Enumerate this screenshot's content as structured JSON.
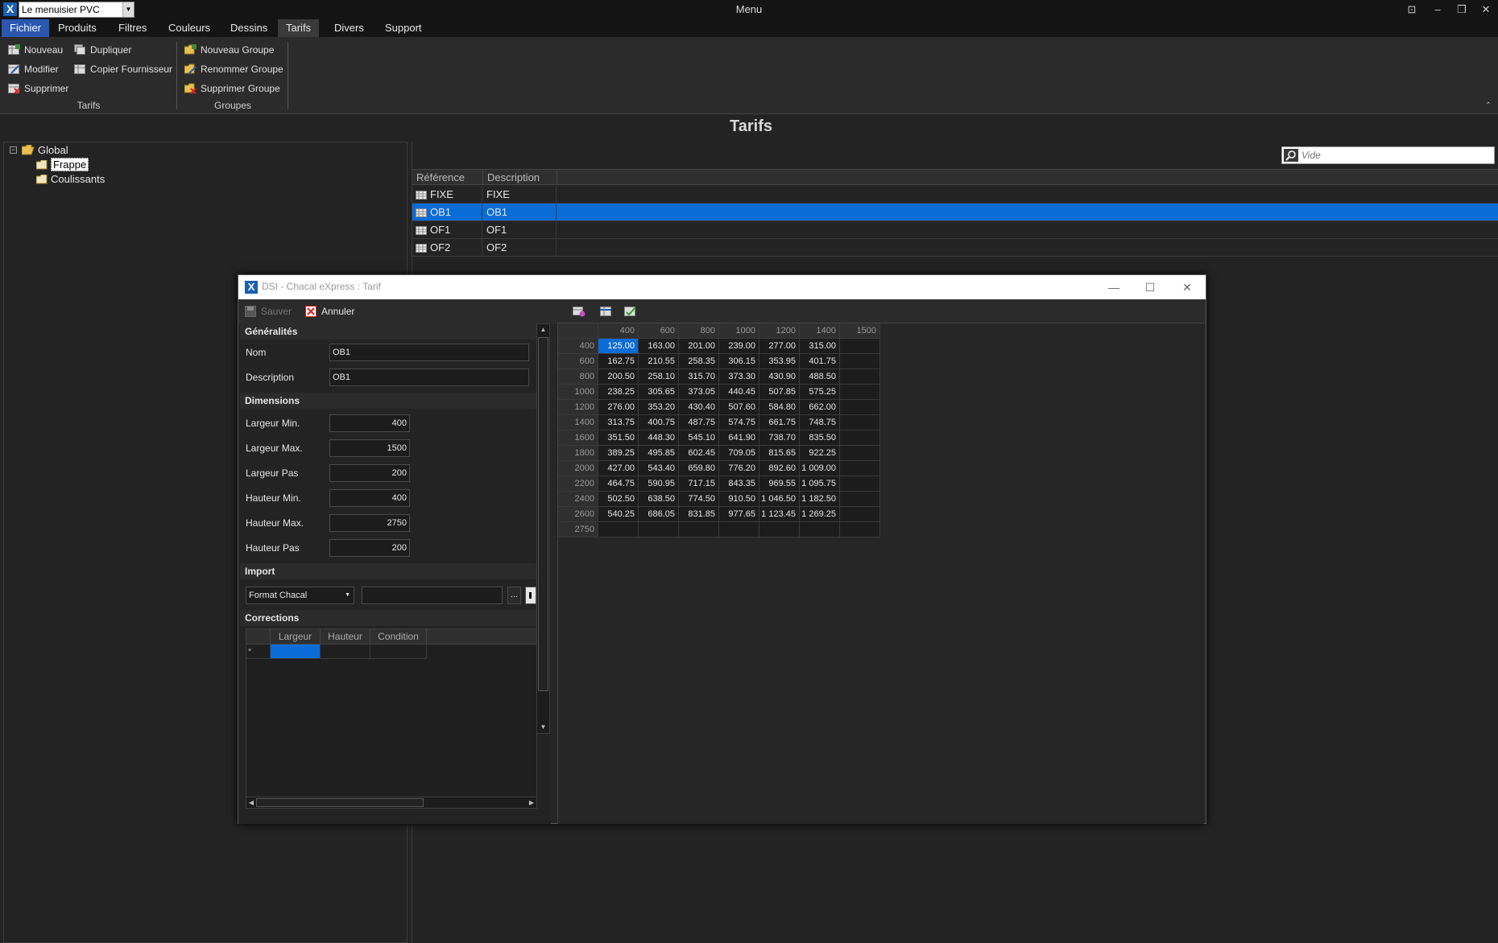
{
  "titlebar": {
    "company": "Le menuisier PVC",
    "title": "Menu"
  },
  "menu": {
    "tabs": [
      "Fichier",
      "Produits",
      "Filtres",
      "Couleurs",
      "Dessins",
      "Tarifs",
      "Divers",
      "Support"
    ]
  },
  "ribbon": {
    "tarifs_group": {
      "label": "Tarifs",
      "nouveau": "Nouveau",
      "modifier": "Modifier",
      "supprimer": "Supprimer",
      "dupliquer": "Dupliquer",
      "copier_fournisseur": "Copier Fournisseur"
    },
    "groupes_group": {
      "label": "Groupes",
      "nouveau_groupe": "Nouveau Groupe",
      "renommer_groupe": "Renommer Groupe",
      "supprimer_groupe": "Supprimer Groupe"
    }
  },
  "page": {
    "title": "Tarifs"
  },
  "tree": {
    "root": "Global",
    "children": [
      "Frappe",
      "Coulissants"
    ]
  },
  "search": {
    "placeholder": "Vide"
  },
  "list": {
    "headers": [
      "Référence",
      "Description"
    ],
    "rows": [
      {
        "ref": "FIXE",
        "desc": "FIXE"
      },
      {
        "ref": "OB1",
        "desc": "OB1"
      },
      {
        "ref": "OF1",
        "desc": "OF1"
      },
      {
        "ref": "OF2",
        "desc": "OF2"
      }
    ]
  },
  "dialog": {
    "title": "DSI - Chacal eXpress : Tarif",
    "toolbar": {
      "save": "Sauver",
      "cancel": "Annuler"
    },
    "sections": {
      "general": "Généralités",
      "dimensions": "Dimensions",
      "import": "Import",
      "corrections": "Corrections"
    },
    "fields": {
      "nom_label": "Nom",
      "nom_value": "OB1",
      "description_label": "Description",
      "description_value": "OB1",
      "largeur_min_label": "Largeur Min.",
      "largeur_min": "400",
      "largeur_max_label": "Largeur Max.",
      "largeur_max": "1500",
      "largeur_pas_label": "Largeur Pas",
      "largeur_pas": "200",
      "hauteur_min_label": "Hauteur Min.",
      "hauteur_min": "400",
      "hauteur_max_label": "Hauteur Max.",
      "hauteur_max": "2750",
      "hauteur_pas_label": "Hauteur Pas",
      "hauteur_pas": "200"
    },
    "import": {
      "format": "Format Chacal",
      "browse": "..."
    },
    "corrections": {
      "headers": [
        "Largeur",
        "Hauteur",
        "Condition"
      ],
      "new_row_marker": "*"
    },
    "price_grid": {
      "columns": [
        "400",
        "600",
        "800",
        "1000",
        "1200",
        "1400",
        "1500"
      ],
      "rows": [
        {
          "h": "400",
          "v": [
            "125.00",
            "163.00",
            "201.00",
            "239.00",
            "277.00",
            "315.00",
            ""
          ]
        },
        {
          "h": "600",
          "v": [
            "162.75",
            "210.55",
            "258.35",
            "306.15",
            "353.95",
            "401.75",
            ""
          ]
        },
        {
          "h": "800",
          "v": [
            "200.50",
            "258.10",
            "315.70",
            "373.30",
            "430.90",
            "488.50",
            ""
          ]
        },
        {
          "h": "1000",
          "v": [
            "238.25",
            "305.65",
            "373.05",
            "440.45",
            "507.85",
            "575.25",
            ""
          ]
        },
        {
          "h": "1200",
          "v": [
            "276.00",
            "353.20",
            "430.40",
            "507.60",
            "584.80",
            "662.00",
            ""
          ]
        },
        {
          "h": "1400",
          "v": [
            "313.75",
            "400.75",
            "487.75",
            "574.75",
            "661.75",
            "748.75",
            ""
          ]
        },
        {
          "h": "1600",
          "v": [
            "351.50",
            "448.30",
            "545.10",
            "641.90",
            "738.70",
            "835.50",
            ""
          ]
        },
        {
          "h": "1800",
          "v": [
            "389.25",
            "495.85",
            "602.45",
            "709.05",
            "815.65",
            "922.25",
            ""
          ]
        },
        {
          "h": "2000",
          "v": [
            "427.00",
            "543.40",
            "659.80",
            "776.20",
            "892.60",
            "1 009.00",
            ""
          ]
        },
        {
          "h": "2200",
          "v": [
            "464.75",
            "590.95",
            "717.15",
            "843.35",
            "969.55",
            "1 095.75",
            ""
          ]
        },
        {
          "h": "2400",
          "v": [
            "502.50",
            "638.50",
            "774.50",
            "910.50",
            "1 046.50",
            "1 182.50",
            ""
          ]
        },
        {
          "h": "2600",
          "v": [
            "540.25",
            "686.05",
            "831.85",
            "977.65",
            "1 123.45",
            "1 269.25",
            ""
          ]
        },
        {
          "h": "2750",
          "v": [
            "",
            "",
            "",
            "",
            "",
            "",
            ""
          ]
        }
      ]
    }
  },
  "colors": {
    "accent": "#0a6cd6",
    "file_tab": "#2a57b0",
    "background": "#232323"
  }
}
